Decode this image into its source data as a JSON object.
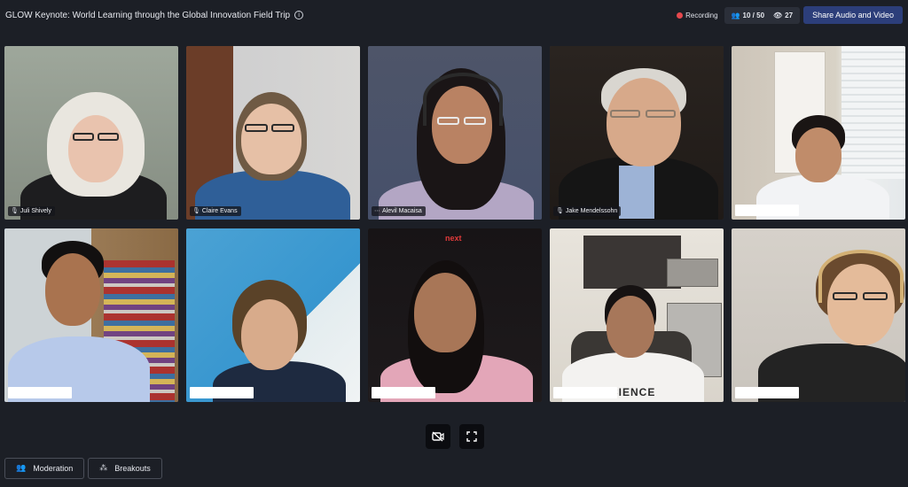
{
  "header": {
    "title": "GLOW Keynote: World Learning through the Global Innovation Field Trip",
    "info_icon": "i",
    "recording_label": "Recording",
    "participants_count": "10 / 50",
    "viewers_count": "27",
    "share_button_label": "Share Audio and Video"
  },
  "tiles": [
    {
      "name": "Juli Shively"
    },
    {
      "name": "Claire Evans"
    },
    {
      "name": "Alevil Macaisa"
    },
    {
      "name": "Jake Mendelssohn"
    },
    {
      "name": ""
    },
    {
      "name": ""
    },
    {
      "name": ""
    },
    {
      "name": ""
    },
    {
      "name": ""
    },
    {
      "name": ""
    }
  ],
  "scene_text": {
    "tv_text": "next",
    "shirt_text": "CIENCE"
  },
  "controls": {
    "camera_off_icon": "camera-off-icon",
    "fullscreen_icon": "fullscreen-icon"
  },
  "bottom": {
    "moderation_label": "Moderation",
    "breakouts_label": "Breakouts"
  },
  "colors": {
    "background": "#1c1f26",
    "share_button": "#2c3e7a",
    "recording_dot": "#e5484d",
    "active_speaker_border": "#4f6bd8"
  }
}
